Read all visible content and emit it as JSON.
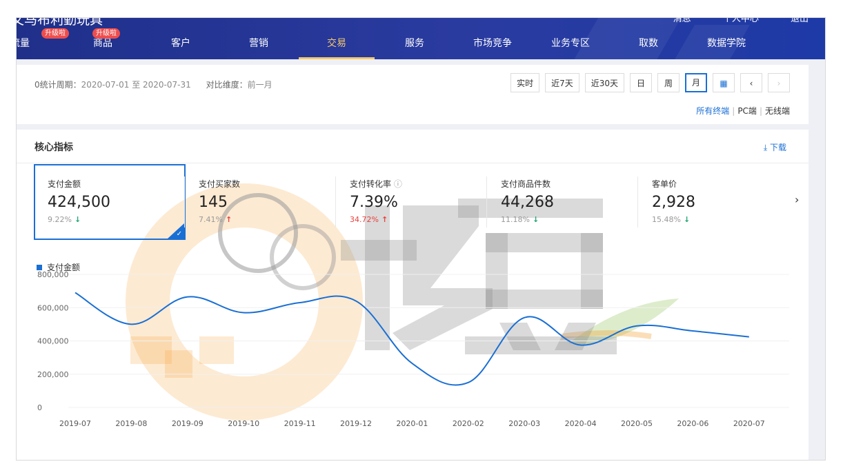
{
  "header": {
    "shop_name": "文马布利勤玩具",
    "top_links": [
      "消息",
      "个人中心",
      "退出"
    ],
    "nav": [
      {
        "label": "流量",
        "badge": "升级啦"
      },
      {
        "label": "商品",
        "badge": "升级啦"
      },
      {
        "label": "客户",
        "badge": ""
      },
      {
        "label": "营销",
        "badge": ""
      },
      {
        "label": "交易",
        "badge": "",
        "active": true
      },
      {
        "label": "服务",
        "badge": ""
      },
      {
        "label": "市场竞争",
        "badge": ""
      },
      {
        "label": "业务专区",
        "badge": ""
      },
      {
        "label": "取数",
        "badge": ""
      },
      {
        "label": "数据学院",
        "badge": ""
      }
    ]
  },
  "filter": {
    "period_label": "0统计周期：",
    "period_value": "2020-07-01 至 2020-07-31",
    "compare_label": "对比维度：",
    "compare_value": "前一月",
    "buttons": [
      "实时",
      "近7天",
      "近30天",
      "日",
      "周",
      "月"
    ],
    "active_button": "月",
    "terminals": [
      "所有终端",
      "PC端",
      "无线端"
    ],
    "selected_terminal": "所有终端"
  },
  "core": {
    "title": "核心指标",
    "download": "下载",
    "metrics": [
      {
        "label": "支付金额",
        "value": "424,500",
        "delta": "9.22%",
        "direction": "down",
        "selected": true
      },
      {
        "label": "支付买家数",
        "value": "145",
        "delta": "7.41%",
        "direction": "up",
        "selected": false
      },
      {
        "label": "支付转化率",
        "value": "7.39%",
        "delta": "34.72%",
        "direction": "up",
        "selected": false,
        "help": true
      },
      {
        "label": "支付商品件数",
        "value": "44,268",
        "delta": "11.18%",
        "direction": "down",
        "selected": false
      },
      {
        "label": "客单价",
        "value": "2,928",
        "delta": "15.48%",
        "direction": "down",
        "selected": false
      }
    ]
  },
  "watermark": "炫豆",
  "colors": {
    "accent": "#1a6fd4",
    "nav_bg": "#1f2f8a",
    "active_nav": "#f5c86b",
    "up": "#e8423d",
    "down": "#1ea672"
  },
  "chart_data": {
    "type": "line",
    "legend": "支付金额",
    "x": [
      "2019-07",
      "2019-08",
      "2019-09",
      "2019-10",
      "2019-11",
      "2019-12",
      "2020-01",
      "2020-02",
      "2020-03",
      "2020-04",
      "2020-05",
      "2020-06",
      "2020-07"
    ],
    "y_ticks": [
      "800,000",
      "600,000",
      "400,000",
      "200,000",
      "0"
    ],
    "ylim": [
      0,
      800000
    ],
    "grid": true,
    "series": [
      {
        "name": "支付金额",
        "values": [
          690000,
          500000,
          665000,
          570000,
          630000,
          640000,
          265000,
          150000,
          540000,
          375000,
          490000,
          460000,
          424500
        ]
      }
    ]
  }
}
